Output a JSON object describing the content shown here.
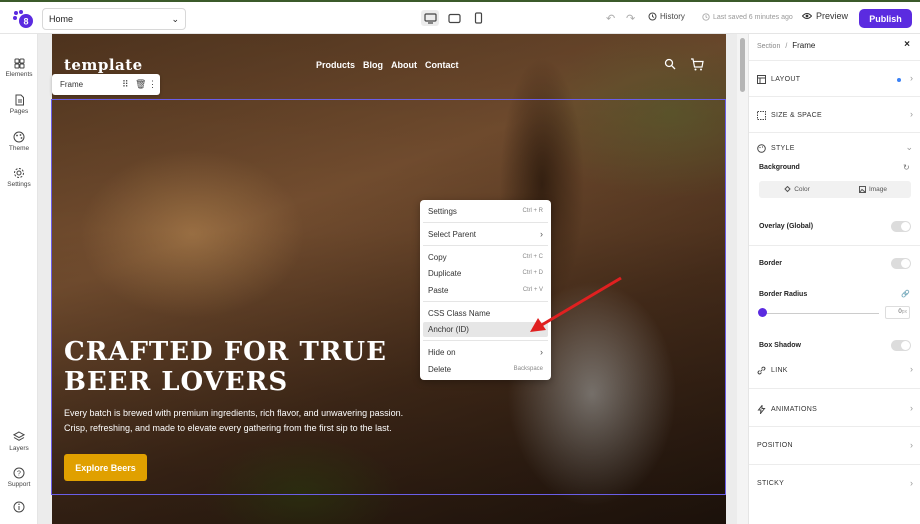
{
  "topbar": {
    "page_select": "Home",
    "history_label": "History",
    "saved_label": "Last saved 6 minutes ago",
    "preview_label": "Preview",
    "publish_label": "Publish"
  },
  "leftbar": {
    "elements": "Elements",
    "pages": "Pages",
    "theme": "Theme",
    "settings": "Settings",
    "layers": "Layers",
    "support": "Support"
  },
  "site": {
    "logo": "template",
    "nav": [
      "Products",
      "Blog",
      "About",
      "Contact"
    ],
    "hero_title_line1": "CRAFTED FOR TRUE",
    "hero_title_line2": "BEER LOVERS",
    "hero_desc": "Every batch is brewed with premium ingredients, rich flavor, and unwavering passion. Crisp, refreshing, and made to elevate every gathering from the first sip to the last.",
    "hero_button": "Explore Beers"
  },
  "frame_tag": {
    "label": "Frame"
  },
  "context_menu": {
    "items": [
      {
        "label": "Settings",
        "shortcut": "Ctrl + R"
      },
      {
        "label": "Select Parent",
        "shortcut": ""
      },
      {
        "label": "Copy",
        "shortcut": "Ctrl + C"
      },
      {
        "label": "Duplicate",
        "shortcut": "Ctrl + D"
      },
      {
        "label": "Paste",
        "shortcut": "Ctrl + V"
      },
      {
        "label": "CSS Class Name",
        "shortcut": ""
      },
      {
        "label": "Anchor (ID)",
        "shortcut": ""
      },
      {
        "label": "Hide on",
        "shortcut": ""
      },
      {
        "label": "Delete",
        "shortcut": "Backspace"
      }
    ]
  },
  "panel": {
    "crumb_parent": "Section",
    "crumb_sep": "/",
    "crumb_current": "Frame",
    "layout": "LAYOUT",
    "size_space": "SIZE & SPACE",
    "style": "STYLE",
    "background": "Background",
    "color_tab": "Color",
    "image_tab": "Image",
    "overlay": "Overlay (Global)",
    "border": "Border",
    "border_radius": "Border Radius",
    "radius_value": "0",
    "radius_unit": "px",
    "box_shadow": "Box Shadow",
    "link": "LINK",
    "animations": "ANIMATIONS",
    "position": "POSITION",
    "sticky": "STICKY"
  },
  "colors": {
    "accent": "#5b2be0",
    "hero_button": "#e0a000",
    "selection": "#6a5ee8",
    "arrow": "#e02020"
  }
}
